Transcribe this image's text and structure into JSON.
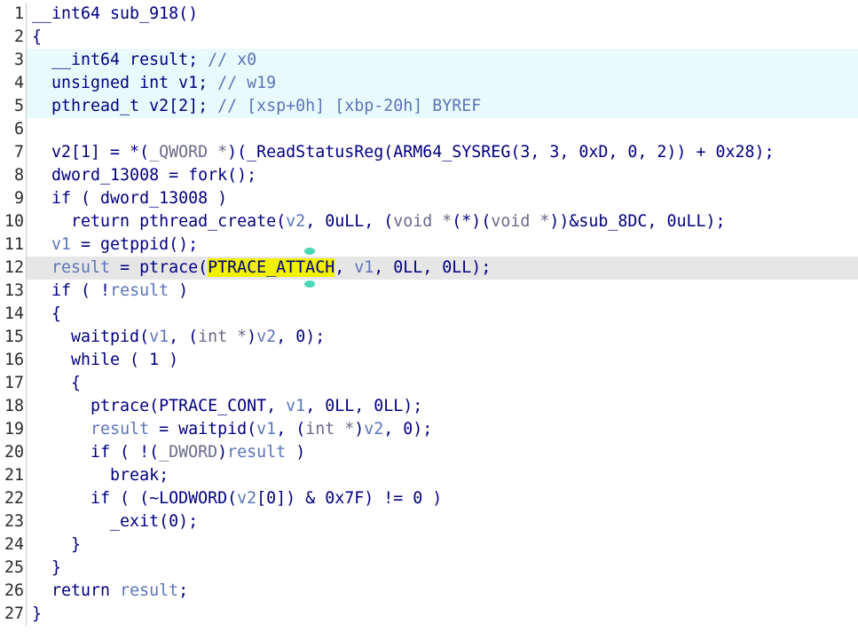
{
  "editor": {
    "lines": [
      {
        "num": "1",
        "tokens": [
          {
            "t": "__int64 sub_918()",
            "c": "tok-default"
          }
        ]
      },
      {
        "num": "2",
        "tokens": [
          {
            "t": "{",
            "c": "tok-default"
          }
        ]
      },
      {
        "num": "3",
        "tokens": [
          {
            "t": "  __int64 result; ",
            "c": "tok-default"
          },
          {
            "t": "// x0",
            "c": "tok-comment"
          }
        ]
      },
      {
        "num": "4",
        "tokens": [
          {
            "t": "  unsigned int v1; ",
            "c": "tok-default"
          },
          {
            "t": "// w19",
            "c": "tok-comment"
          }
        ]
      },
      {
        "num": "5",
        "tokens": [
          {
            "t": "  pthread_t v2[2]; ",
            "c": "tok-default"
          },
          {
            "t": "// [xsp+0h] [xbp-20h] BYREF",
            "c": "tok-comment"
          }
        ]
      },
      {
        "num": "6",
        "tokens": []
      },
      {
        "num": "7",
        "tokens": [
          {
            "t": "  v2[1] = *(",
            "c": "tok-default"
          },
          {
            "t": "_QWORD *",
            "c": "tok-type"
          },
          {
            "t": ")(_ReadStatusReg(ARM64_SYSREG(3, 3, 0xD, 0, 2)) + 0x28);",
            "c": "tok-default"
          }
        ]
      },
      {
        "num": "8",
        "tokens": [
          {
            "t": "  dword_13008 = fork();",
            "c": "tok-default"
          }
        ]
      },
      {
        "num": "9",
        "tokens": [
          {
            "t": "  if ( dword_13008 )",
            "c": "tok-default"
          }
        ]
      },
      {
        "num": "10",
        "tokens": [
          {
            "t": "    return pthread_create(",
            "c": "tok-default"
          },
          {
            "t": "v2",
            "c": "tok-var"
          },
          {
            "t": ", 0uLL, (",
            "c": "tok-default"
          },
          {
            "t": "void *",
            "c": "tok-type"
          },
          {
            "t": "(*)(",
            "c": "tok-default"
          },
          {
            "t": "void *",
            "c": "tok-type"
          },
          {
            "t": "))&sub_8DC, 0uLL);",
            "c": "tok-default"
          }
        ]
      },
      {
        "num": "11",
        "tokens": [
          {
            "t": "  ",
            "c": "tok-default"
          },
          {
            "t": "v1",
            "c": "tok-var"
          },
          {
            "t": " = getppid();",
            "c": "tok-default"
          }
        ]
      },
      {
        "num": "12",
        "tokens": [
          {
            "t": "  ",
            "c": "tok-default"
          },
          {
            "t": "result",
            "c": "tok-var"
          },
          {
            "t": " = ptrace(",
            "c": "tok-default"
          },
          {
            "t": "PTRACE_ATTACH",
            "c": "tok-hl"
          },
          {
            "t": ", ",
            "c": "tok-default"
          },
          {
            "t": "v1",
            "c": "tok-var"
          },
          {
            "t": ", 0LL, 0LL);",
            "c": "tok-default"
          }
        ]
      },
      {
        "num": "13",
        "tokens": [
          {
            "t": "  if ( !",
            "c": "tok-default"
          },
          {
            "t": "result",
            "c": "tok-var"
          },
          {
            "t": " )",
            "c": "tok-default"
          }
        ]
      },
      {
        "num": "14",
        "tokens": [
          {
            "t": "  {",
            "c": "tok-default"
          }
        ]
      },
      {
        "num": "15",
        "tokens": [
          {
            "t": "    waitpid(",
            "c": "tok-default"
          },
          {
            "t": "v1",
            "c": "tok-var"
          },
          {
            "t": ", (",
            "c": "tok-default"
          },
          {
            "t": "int *",
            "c": "tok-type"
          },
          {
            "t": ")",
            "c": "tok-default"
          },
          {
            "t": "v2",
            "c": "tok-var"
          },
          {
            "t": ", 0);",
            "c": "tok-default"
          }
        ]
      },
      {
        "num": "16",
        "tokens": [
          {
            "t": "    while ( 1 )",
            "c": "tok-default"
          }
        ]
      },
      {
        "num": "17",
        "tokens": [
          {
            "t": "    {",
            "c": "tok-default"
          }
        ]
      },
      {
        "num": "18",
        "tokens": [
          {
            "t": "      ptrace(PTRACE_CONT, ",
            "c": "tok-default"
          },
          {
            "t": "v1",
            "c": "tok-var"
          },
          {
            "t": ", 0LL, 0LL);",
            "c": "tok-default"
          }
        ]
      },
      {
        "num": "19",
        "tokens": [
          {
            "t": "      ",
            "c": "tok-default"
          },
          {
            "t": "result",
            "c": "tok-var"
          },
          {
            "t": " = waitpid(",
            "c": "tok-default"
          },
          {
            "t": "v1",
            "c": "tok-var"
          },
          {
            "t": ", (",
            "c": "tok-default"
          },
          {
            "t": "int *",
            "c": "tok-type"
          },
          {
            "t": ")",
            "c": "tok-default"
          },
          {
            "t": "v2",
            "c": "tok-var"
          },
          {
            "t": ", 0);",
            "c": "tok-default"
          }
        ]
      },
      {
        "num": "20",
        "tokens": [
          {
            "t": "      if ( !(",
            "c": "tok-default"
          },
          {
            "t": "_DWORD",
            "c": "tok-type"
          },
          {
            "t": ")",
            "c": "tok-default"
          },
          {
            "t": "result",
            "c": "tok-var"
          },
          {
            "t": " )",
            "c": "tok-default"
          }
        ]
      },
      {
        "num": "21",
        "tokens": [
          {
            "t": "        break;",
            "c": "tok-default"
          }
        ]
      },
      {
        "num": "22",
        "tokens": [
          {
            "t": "      if ( (~LODWORD(",
            "c": "tok-default"
          },
          {
            "t": "v2",
            "c": "tok-var"
          },
          {
            "t": "[0]) & 0x7F) != 0 )",
            "c": "tok-default"
          }
        ]
      },
      {
        "num": "23",
        "tokens": [
          {
            "t": "        _exit(0);",
            "c": "tok-default"
          }
        ]
      },
      {
        "num": "24",
        "tokens": [
          {
            "t": "    }",
            "c": "tok-default"
          }
        ]
      },
      {
        "num": "25",
        "tokens": [
          {
            "t": "  }",
            "c": "tok-default"
          }
        ]
      },
      {
        "num": "26",
        "tokens": [
          {
            "t": "  return ",
            "c": "tok-default"
          },
          {
            "t": "result",
            "c": "tok-var"
          },
          {
            "t": ";",
            "c": "tok-default"
          }
        ]
      },
      {
        "num": "27",
        "tokens": [
          {
            "t": "}",
            "c": "tok-default"
          }
        ]
      }
    ],
    "shaded_lines": [
      "3",
      "4",
      "5"
    ],
    "current_line": "12"
  },
  "colors": {
    "default": "#000080",
    "variable": "#5c74b8",
    "comment": "#5c74b8",
    "highlight": "#f0f000",
    "declaration_bg": "#e8fafb",
    "current_line_bg": "#e6e6e6"
  }
}
